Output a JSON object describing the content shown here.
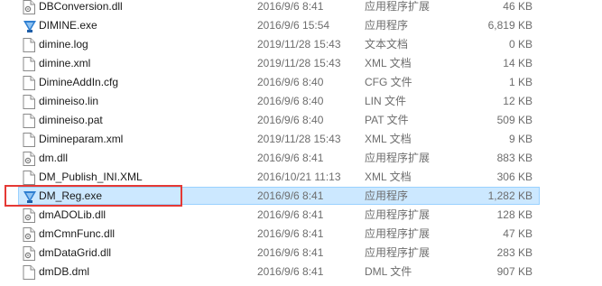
{
  "colors": {
    "selection_bg": "#cce8ff",
    "selection_border": "#99d1ff",
    "highlight_box": "#e53935",
    "secondary_text": "#6d6d6d"
  },
  "files": [
    {
      "name": "DBConversion.dll",
      "date": "2016/9/6 8:41",
      "type": "应用程序扩展",
      "size": "46 KB",
      "icon": "dll-icon"
    },
    {
      "name": "DIMINE.exe",
      "date": "2016/9/6 15:54",
      "type": "应用程序",
      "size": "6,819 KB",
      "icon": "exe-icon"
    },
    {
      "name": "dimine.log",
      "date": "2019/11/28 15:43",
      "type": "文本文档",
      "size": "0 KB",
      "icon": "document-icon"
    },
    {
      "name": "dimine.xml",
      "date": "2019/11/28 15:43",
      "type": "XML 文档",
      "size": "14 KB",
      "icon": "document-icon"
    },
    {
      "name": "DimineAddIn.cfg",
      "date": "2016/9/6 8:40",
      "type": "CFG 文件",
      "size": "1 KB",
      "icon": "document-icon"
    },
    {
      "name": "dimineiso.lin",
      "date": "2016/9/6 8:40",
      "type": "LIN 文件",
      "size": "12 KB",
      "icon": "document-icon"
    },
    {
      "name": "dimineiso.pat",
      "date": "2016/9/6 8:40",
      "type": "PAT 文件",
      "size": "509 KB",
      "icon": "document-icon"
    },
    {
      "name": "Dimineparam.xml",
      "date": "2019/11/28 15:43",
      "type": "XML 文档",
      "size": "9 KB",
      "icon": "document-icon"
    },
    {
      "name": "dm.dll",
      "date": "2016/9/6 8:41",
      "type": "应用程序扩展",
      "size": "883 KB",
      "icon": "dll-icon"
    },
    {
      "name": "DM_Publish_INI.XML",
      "date": "2016/10/21 11:13",
      "type": "XML 文档",
      "size": "306 KB",
      "icon": "document-icon"
    },
    {
      "name": "DM_Reg.exe",
      "date": "2016/9/6 8:41",
      "type": "应用程序",
      "size": "1,282 KB",
      "icon": "exe-icon",
      "selected": true
    },
    {
      "name": "dmADOLib.dll",
      "date": "2016/9/6 8:41",
      "type": "应用程序扩展",
      "size": "128 KB",
      "icon": "dll-icon"
    },
    {
      "name": "dmCmnFunc.dll",
      "date": "2016/9/6 8:41",
      "type": "应用程序扩展",
      "size": "47 KB",
      "icon": "dll-icon"
    },
    {
      "name": "dmDataGrid.dll",
      "date": "2016/9/6 8:41",
      "type": "应用程序扩展",
      "size": "283 KB",
      "icon": "dll-icon"
    },
    {
      "name": "dmDB.dml",
      "date": "2016/9/6 8:41",
      "type": "DML 文件",
      "size": "907 KB",
      "icon": "document-icon"
    }
  ]
}
